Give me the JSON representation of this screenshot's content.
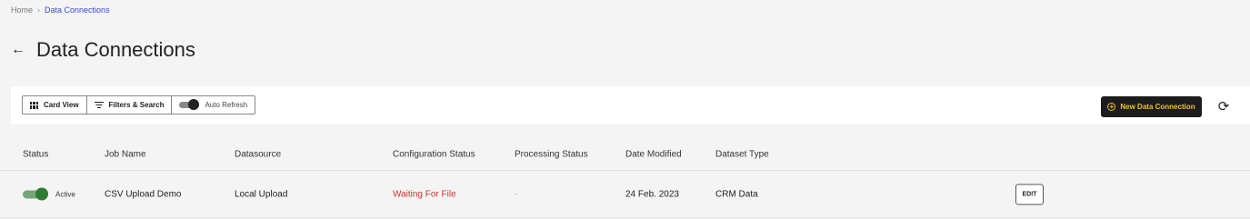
{
  "breadcrumb": {
    "home": "Home",
    "separator": "›",
    "current": "Data Connections"
  },
  "header": {
    "back_icon": "←",
    "title": "Data Connections"
  },
  "toolbar": {
    "card_view_label": "Card View",
    "filters_label": "Filters & Search",
    "auto_refresh_label": "Auto Refresh",
    "auto_refresh_on": true,
    "new_connection_label": "New Data Connection",
    "plus_icon": "+",
    "refresh_icon": "⟳",
    "accent_color": "#f0c419"
  },
  "table": {
    "columns": [
      "Status",
      "Job Name",
      "Datasource",
      "Configuration Status",
      "Processing Status",
      "Date Modified",
      "Dataset Type"
    ],
    "rows": [
      {
        "status": "Active",
        "status_on": true,
        "job_name": "CSV Upload Demo",
        "datasource": "Local Upload",
        "configuration_status": "Waiting For File",
        "processing_status": "-",
        "date_modified": "24 Feb. 2023",
        "dataset_type": "CRM Data",
        "edit_label": "EDIT"
      }
    ]
  },
  "colors": {
    "link": "#3b4bd6",
    "error": "#d32f2f",
    "active_green": "#2e7d32"
  }
}
